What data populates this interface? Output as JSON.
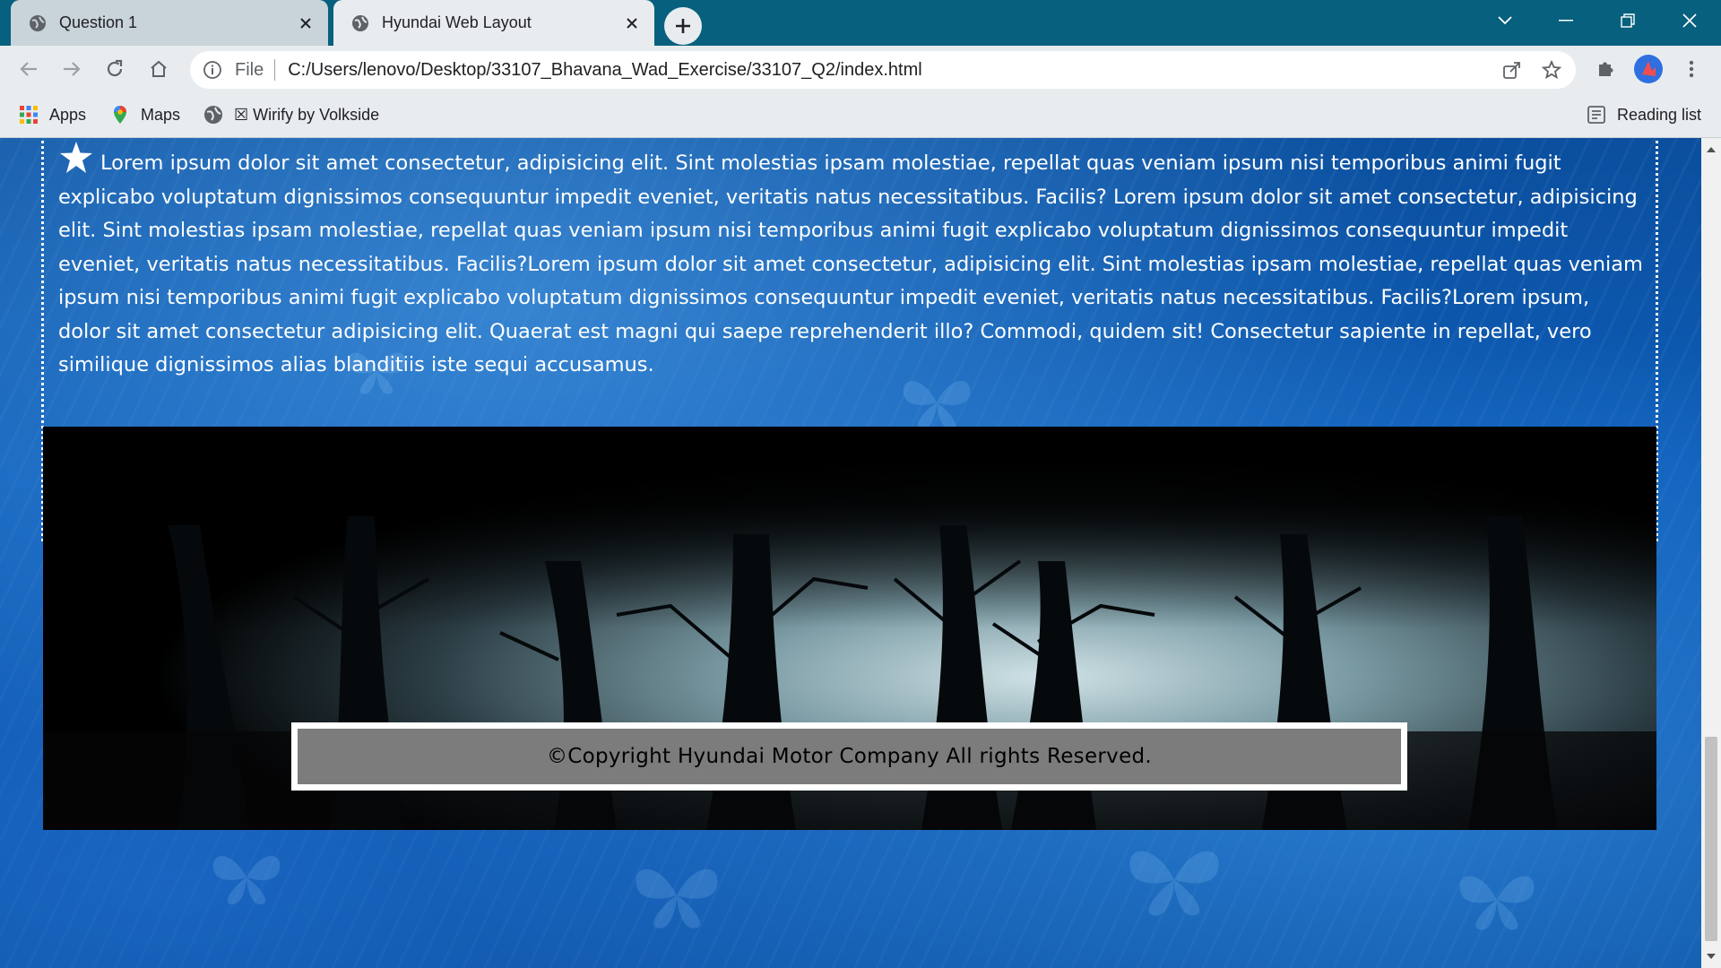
{
  "browser": {
    "tabs": [
      {
        "title": "Question 1",
        "active": false
      },
      {
        "title": "Hyundai Web Layout",
        "active": true
      }
    ],
    "address": {
      "scheme": "File",
      "url": "C:/Users/lenovo/Desktop/33107_Bhavana_Wad_Exercise/33107_Q2/index.html"
    },
    "bookmarks": [
      {
        "label": "Apps",
        "icon": "apps-grid-icon"
      },
      {
        "label": "Maps",
        "icon": "maps-pin-icon"
      },
      {
        "label": "☒ Wirify by Volkside",
        "icon": "globe-icon"
      }
    ],
    "reading_list": "Reading list"
  },
  "page": {
    "paragraph": "Lorem ipsum dolor sit amet consectetur, adipisicing elit. Sint molestias ipsam molestiae, repellat quas veniam ipsum nisi temporibus animi fugit explicabo voluptatum dignissimos consequuntur impedit eveniet, veritatis natus necessitatibus. Facilis? Lorem ipsum dolor sit amet consectetur, adipisicing elit. Sint molestias ipsam molestiae, repellat quas veniam ipsum nisi temporibus animi fugit explicabo voluptatum dignissimos consequuntur impedit eveniet, veritatis natus necessitatibus. Facilis?Lorem ipsum dolor sit amet consectetur, adipisicing elit. Sint molestias ipsam molestiae, repellat quas veniam ipsum nisi temporibus animi fugit explicabo voluptatum dignissimos consequuntur impedit eveniet, veritatis natus necessitatibus. Facilis?Lorem ipsum, dolor sit amet consectetur adipisicing elit. Quaerat est magni qui saepe reprehenderit illo? Commodi, quidem sit! Consectetur sapiente in repellat, vero similique dignissimos alias blanditiis iste sequi accusamus.",
    "copyright": "©Copyright Hyundai Motor Company All rights Reserved."
  },
  "colors": {
    "tabstrip": "#06607e",
    "toolbar": "#e8ecef",
    "page_blue": "#0d5db8",
    "copyright_bg": "#7c7c7c"
  }
}
